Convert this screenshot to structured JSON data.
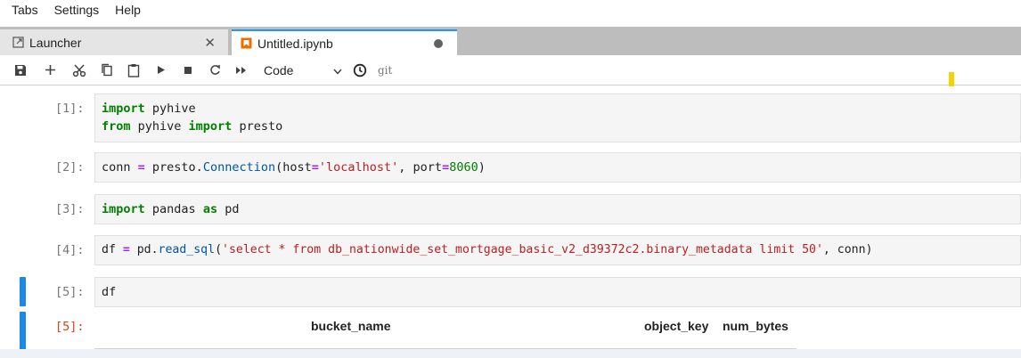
{
  "menu": {
    "items": [
      "Tabs",
      "Settings",
      "Help"
    ]
  },
  "tabs": {
    "launcher": {
      "label": "Launcher",
      "close": "✕"
    },
    "notebook": {
      "label": "Untitled.ipynb"
    }
  },
  "toolbar": {
    "cell_type": "Code",
    "git_label": "git"
  },
  "cells": [
    {
      "prompt": "[1]:"
    },
    {
      "prompt": "[2]:"
    },
    {
      "prompt": "[3]:"
    },
    {
      "prompt": "[4]:"
    },
    {
      "prompt": "[5]:"
    },
    {
      "prompt": "[5]:"
    }
  ],
  "code": {
    "c1_import": "import",
    "c1_mod": " pyhive",
    "c1_from": "from",
    "c1_mod2": " pyhive ",
    "c1_import2": "import",
    "c1_rest": " presto",
    "c2_a": "conn ",
    "c2_eq": "=",
    "c2_b": " presto.",
    "c2_fn": "Connection",
    "c2_c": "(host",
    "c2_eq2": "=",
    "c2_str": "'localhost'",
    "c2_d": ", port",
    "c2_eq3": "=",
    "c2_num": "8060",
    "c2_e": ")",
    "c3_import": "import",
    "c3_b": " pandas ",
    "c3_as": "as",
    "c3_c": " pd",
    "c4_a": "df ",
    "c4_eq": "=",
    "c4_b": " pd.",
    "c4_fn": "read_sql",
    "c4_c": "(",
    "c4_str": "'select * from db_nationwide_set_mortgage_basic_v2_d39372c2.binary_metadata limit 50'",
    "c4_d": ", conn)",
    "c5": "df"
  },
  "output_table": {
    "columns": [
      "bucket_name",
      "object_key",
      "num_bytes"
    ]
  },
  "colors": {
    "accent": "#1e88e5",
    "tab_active_border": "#2196f3",
    "marker": "#f3d400"
  }
}
